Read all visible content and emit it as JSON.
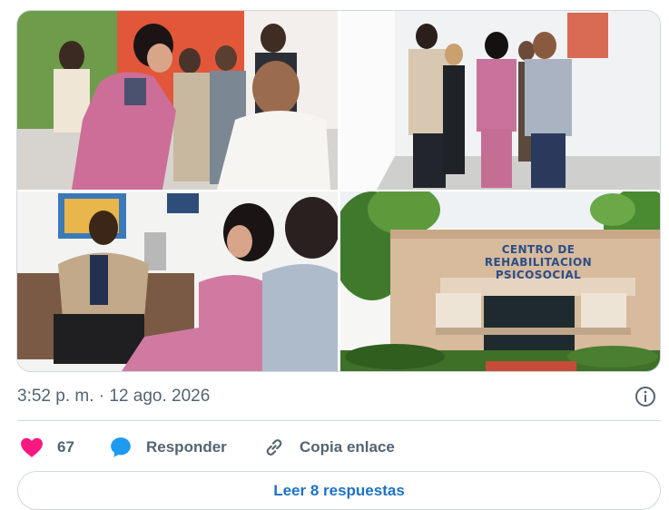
{
  "media": {
    "photos": [
      {
        "alt": "photo-1"
      },
      {
        "alt": "photo-2"
      },
      {
        "alt": "photo-3"
      },
      {
        "alt": "photo-4"
      }
    ],
    "sign_line1": "CENTRO DE",
    "sign_line2": "REHABILITACION PSICOSOCIAL"
  },
  "post": {
    "timestamp": "3:52 p. m. · 12 ago. 2026"
  },
  "actions": {
    "like_count": "67",
    "reply_label": "Responder",
    "copy_label": "Copia enlace"
  },
  "replies_button": {
    "label": "Leer 8 respuestas"
  },
  "icons": {
    "like": "heart-icon",
    "reply": "speech-bubble-icon",
    "copy": "link-icon",
    "info": "info-icon"
  },
  "colors": {
    "like": "#f91880",
    "reply_icon": "#1d9bf0",
    "link": "#1d73c6",
    "muted": "#536471",
    "border": "#cfd9de"
  }
}
